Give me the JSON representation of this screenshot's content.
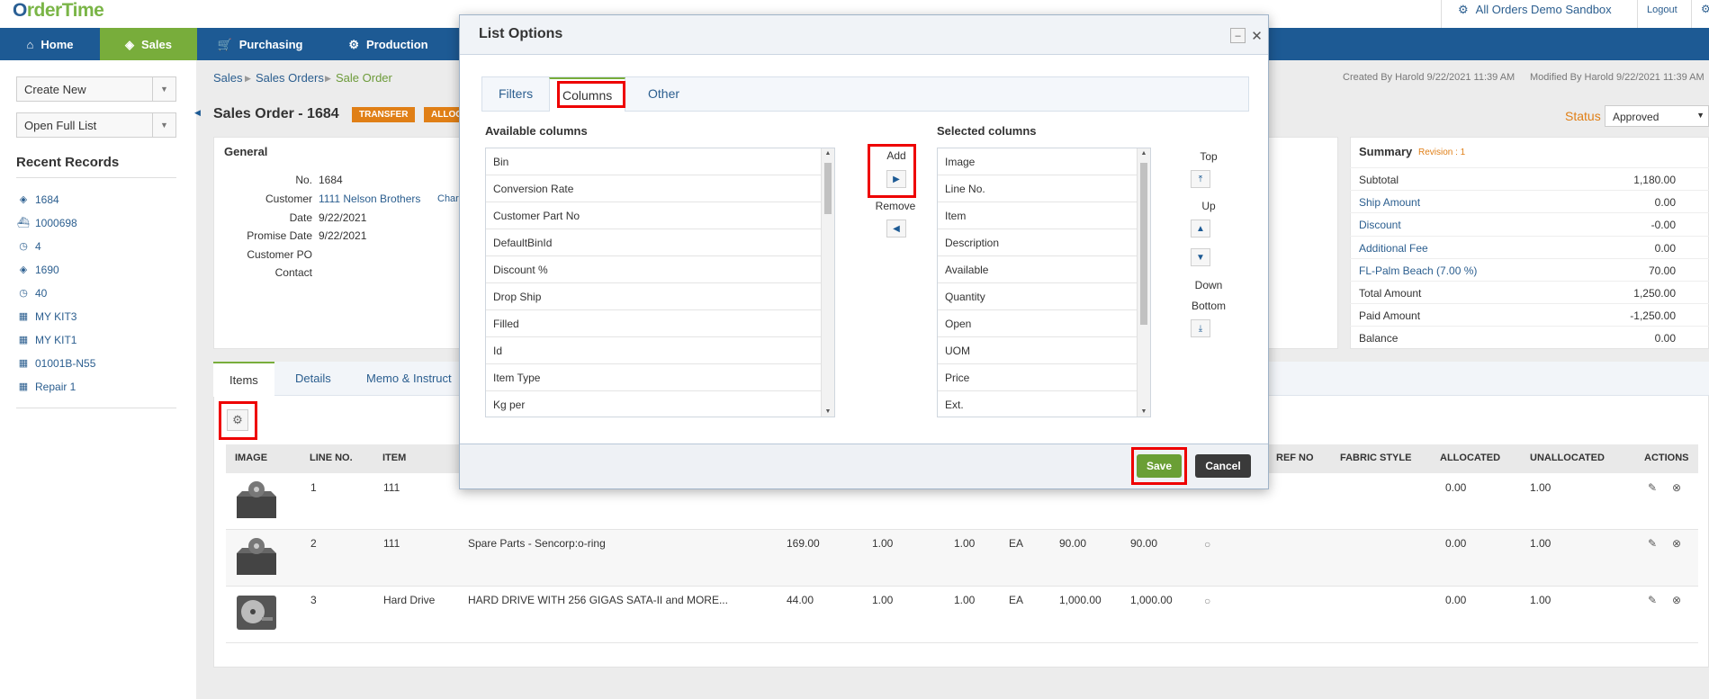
{
  "brand": {
    "logo_main": "rderTime",
    "logo_o": "O"
  },
  "top": {
    "demo": "All Orders Demo Sandbox",
    "logout": "Logout"
  },
  "nav": [
    {
      "label": "Home",
      "icon": "home-icon"
    },
    {
      "label": "Sales",
      "icon": "tag-icon"
    },
    {
      "label": "Purchasing",
      "icon": "cart-icon"
    },
    {
      "label": "Production",
      "icon": "gears-icon"
    }
  ],
  "sidebar": {
    "create_new": "Create New",
    "open_full_list": "Open Full List",
    "recent_title": "Recent Records",
    "recent": [
      {
        "label": "1684",
        "icon": "tag-icon"
      },
      {
        "label": "1000698",
        "icon": "ship-icon"
      },
      {
        "label": "4",
        "icon": "clock-icon"
      },
      {
        "label": "1690",
        "icon": "tag-icon"
      },
      {
        "label": "40",
        "icon": "clock-icon"
      },
      {
        "label": "MY KIT3",
        "icon": "grid-icon"
      },
      {
        "label": "MY KIT1",
        "icon": "grid-icon"
      },
      {
        "label": "01001B-N55",
        "icon": "grid-icon"
      },
      {
        "label": "Repair 1",
        "icon": "grid-icon"
      }
    ]
  },
  "breadcrumb": [
    "Sales",
    "Sales Orders",
    "Sale Order"
  ],
  "created": "Created By Harold 9/22/2021 11:39 AM",
  "modified": "Modified By Harold 9/22/2021 11:39 AM",
  "status": {
    "label": "Status",
    "value": "Approved"
  },
  "order": {
    "title": "Sales Order - 1684",
    "tag1": "TRANSFER",
    "tag2": "ALLOC"
  },
  "general": {
    "title": "General",
    "fields": [
      {
        "label": "No.",
        "value": "1684"
      },
      {
        "label": "Customer",
        "value": "1111 Nelson Brothers",
        "extra": "Char"
      },
      {
        "label": "Date",
        "value": "9/22/2021"
      },
      {
        "label": "Promise Date",
        "value": "9/22/2021"
      },
      {
        "label": "Customer PO",
        "value": ""
      },
      {
        "label": "Contact",
        "value": ""
      }
    ]
  },
  "summary": {
    "title": "Summary",
    "revision": "Revision : 1",
    "rows": [
      {
        "label": "Subtotal",
        "value": "1,180.00",
        "link": false
      },
      {
        "label": "Ship Amount",
        "value": "0.00",
        "link": true
      },
      {
        "label": "Discount",
        "value": "-0.00",
        "link": true
      },
      {
        "label": "Additional Fee",
        "value": "0.00",
        "link": true
      },
      {
        "label": "FL-Palm Beach (7.00 %)",
        "value": "70.00",
        "link": true
      },
      {
        "label": "Total Amount",
        "value": "1,250.00",
        "link": false
      },
      {
        "label": "Paid Amount",
        "value": "-1,250.00",
        "link": false
      },
      {
        "label": "Balance",
        "value": "0.00",
        "link": false
      }
    ]
  },
  "tabs": [
    "Items",
    "Details",
    "Memo & Instruct"
  ],
  "table": {
    "headers": [
      "IMAGE",
      "LINE NO.",
      "ITEM",
      "REF NO",
      "FABRIC STYLE",
      "ALLOCATED",
      "UNALLOCATED",
      "ACTIONS"
    ],
    "rows": [
      {
        "line": "1",
        "item": "111",
        "desc": "",
        "c1": "",
        "c2": "",
        "c3": "",
        "uom": "",
        "c5": "",
        "c6": "",
        "alloc": "0.00",
        "unalloc": "1.00"
      },
      {
        "line": "2",
        "item": "111",
        "desc": "Spare Parts - Sencorp:o-ring",
        "c1": "169.00",
        "c2": "1.00",
        "c3": "1.00",
        "uom": "EA",
        "c5": "90.00",
        "c6": "90.00",
        "alloc": "0.00",
        "unalloc": "1.00"
      },
      {
        "line": "3",
        "item": "Hard Drive",
        "desc": "HARD DRIVE WITH 256 GIGAS SATA-II and MORE...",
        "c1": "44.00",
        "c2": "1.00",
        "c3": "1.00",
        "uom": "EA",
        "c5": "1,000.00",
        "c6": "1,000.00",
        "alloc": "0.00",
        "unalloc": "1.00"
      }
    ]
  },
  "modal": {
    "title": "List Options",
    "tabs": [
      "Filters",
      "Columns",
      "Other"
    ],
    "available_label": "Available columns",
    "selected_label": "Selected columns",
    "available": [
      "Bin",
      "Conversion Rate",
      "Customer Part No",
      "DefaultBinId",
      "Discount %",
      "Drop Ship",
      "Filled",
      "Id",
      "Item Type",
      "Kg per"
    ],
    "selected": [
      "Image",
      "Line No.",
      "Item",
      "Description",
      "Available",
      "Quantity",
      "Open",
      "UOM",
      "Price",
      "Ext."
    ],
    "add": "Add",
    "remove": "Remove",
    "top": "Top",
    "up": "Up",
    "down": "Down",
    "bottom": "Bottom",
    "save": "Save",
    "cancel": "Cancel"
  }
}
